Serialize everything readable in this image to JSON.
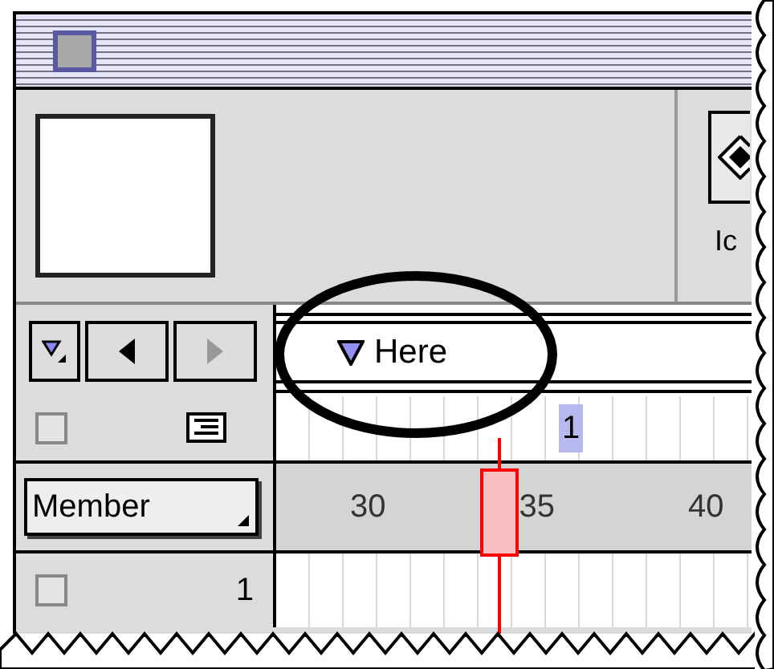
{
  "toolbar": {
    "button_label": "Ic"
  },
  "navigation": [
    {
      "kind": "marker-menu",
      "disabled": false
    },
    {
      "kind": "previous",
      "disabled": false
    },
    {
      "kind": "next",
      "disabled": true
    }
  ],
  "markers": [
    {
      "label": "Here"
    }
  ],
  "channel_header": {
    "selected": false
  },
  "frame_channel": {
    "label": "1",
    "selected": true
  },
  "display_menu": {
    "value": "Member"
  },
  "ruler": {
    "labels": [
      "30",
      "35",
      "40"
    ]
  },
  "channels": [
    {
      "number": "1",
      "selected": false
    }
  ]
}
